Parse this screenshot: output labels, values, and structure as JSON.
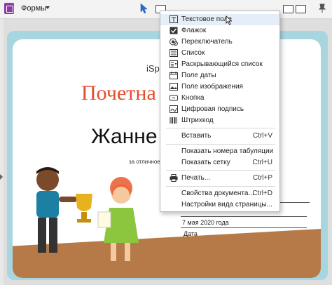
{
  "toolbar": {
    "forms_label": "Формы"
  },
  "certificate": {
    "brand": "iSp",
    "title": "Почетна",
    "name": "Жанне",
    "for_text": "за отличное",
    "date_value": "7 мая 2020 года",
    "date_label": "Дата"
  },
  "menu": {
    "items": [
      {
        "label": "Текстовое поле",
        "icon": "text-field-icon"
      },
      {
        "label": "Флажок",
        "icon": "checkbox-icon"
      },
      {
        "label": "Переключатель",
        "icon": "radio-button-icon"
      },
      {
        "label": "Список",
        "icon": "list-icon"
      },
      {
        "label": "Раскрывающийся список",
        "icon": "dropdown-list-icon"
      },
      {
        "label": "Поле даты",
        "icon": "date-field-icon"
      },
      {
        "label": "Поле изображения",
        "icon": "image-field-icon"
      },
      {
        "label": "Кнопка",
        "icon": "button-icon"
      },
      {
        "label": "Цифровая подпись",
        "icon": "digital-signature-icon"
      },
      {
        "label": "Штрихкод",
        "icon": "barcode-icon"
      }
    ],
    "paste": {
      "label": "Вставить",
      "shortcut": "Ctrl+V"
    },
    "show_tab_numbers": {
      "label": "Показать номера табуляции",
      "shortcut": ""
    },
    "show_grid": {
      "label": "Показать сетку",
      "shortcut": "Ctrl+U"
    },
    "print": {
      "label": "Печать...",
      "shortcut": "Ctrl+P"
    },
    "doc_props": {
      "label": "Свойства документа...",
      "shortcut": "Ctrl+D"
    },
    "page_view": {
      "label": "Настройки вида страницы...",
      "shortcut": ""
    }
  },
  "colors": {
    "accent": "#8b3fa6",
    "title_red": "#e44b2b",
    "cert_border": "#a8d6e0",
    "floor": "#b67a48"
  }
}
